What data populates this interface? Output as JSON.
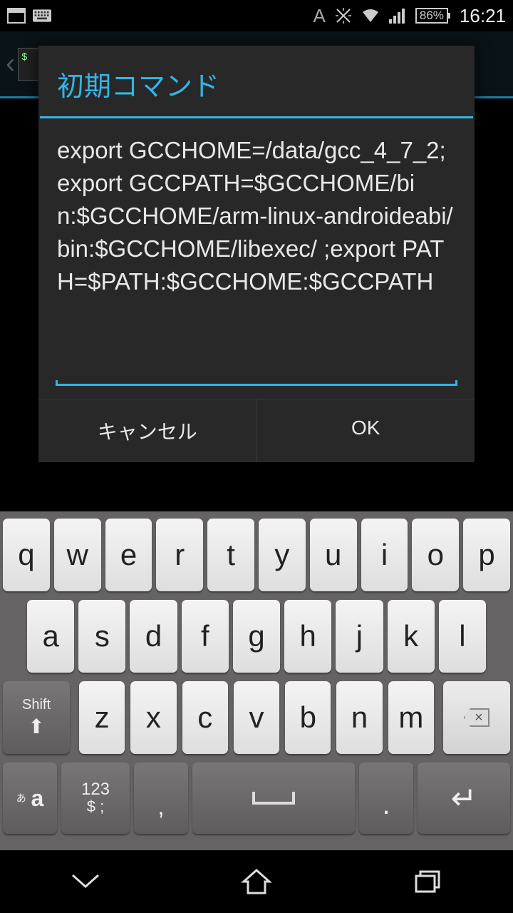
{
  "status": {
    "battery": "86%",
    "clock": "16:21",
    "network_label": "A"
  },
  "dialog": {
    "title": "初期コマンド",
    "input_value": "export GCCHOME=/data/gcc_4_7_2; export GCCPATH=$GCCHOME/bin:$GCCHOME/arm-linux-androideabi/bin:$GCCHOME/libexec/ ;export PATH=$PATH:$GCCHOME:$GCCPATH",
    "cancel_label": "キャンセル",
    "ok_label": "OK"
  },
  "keyboard": {
    "row1": [
      "q",
      "w",
      "e",
      "r",
      "t",
      "y",
      "u",
      "i",
      "o",
      "p"
    ],
    "row2": [
      "a",
      "s",
      "d",
      "f",
      "g",
      "h",
      "j",
      "k",
      "l"
    ],
    "row3": [
      "z",
      "x",
      "c",
      "v",
      "b",
      "n",
      "m"
    ],
    "shift_label": "Shift",
    "mode_label_small": "あ",
    "mode_label_big": "a",
    "sym_label_top": "123",
    "sym_label_bottom": "$ ;",
    "comma": ",",
    "dot": "."
  }
}
